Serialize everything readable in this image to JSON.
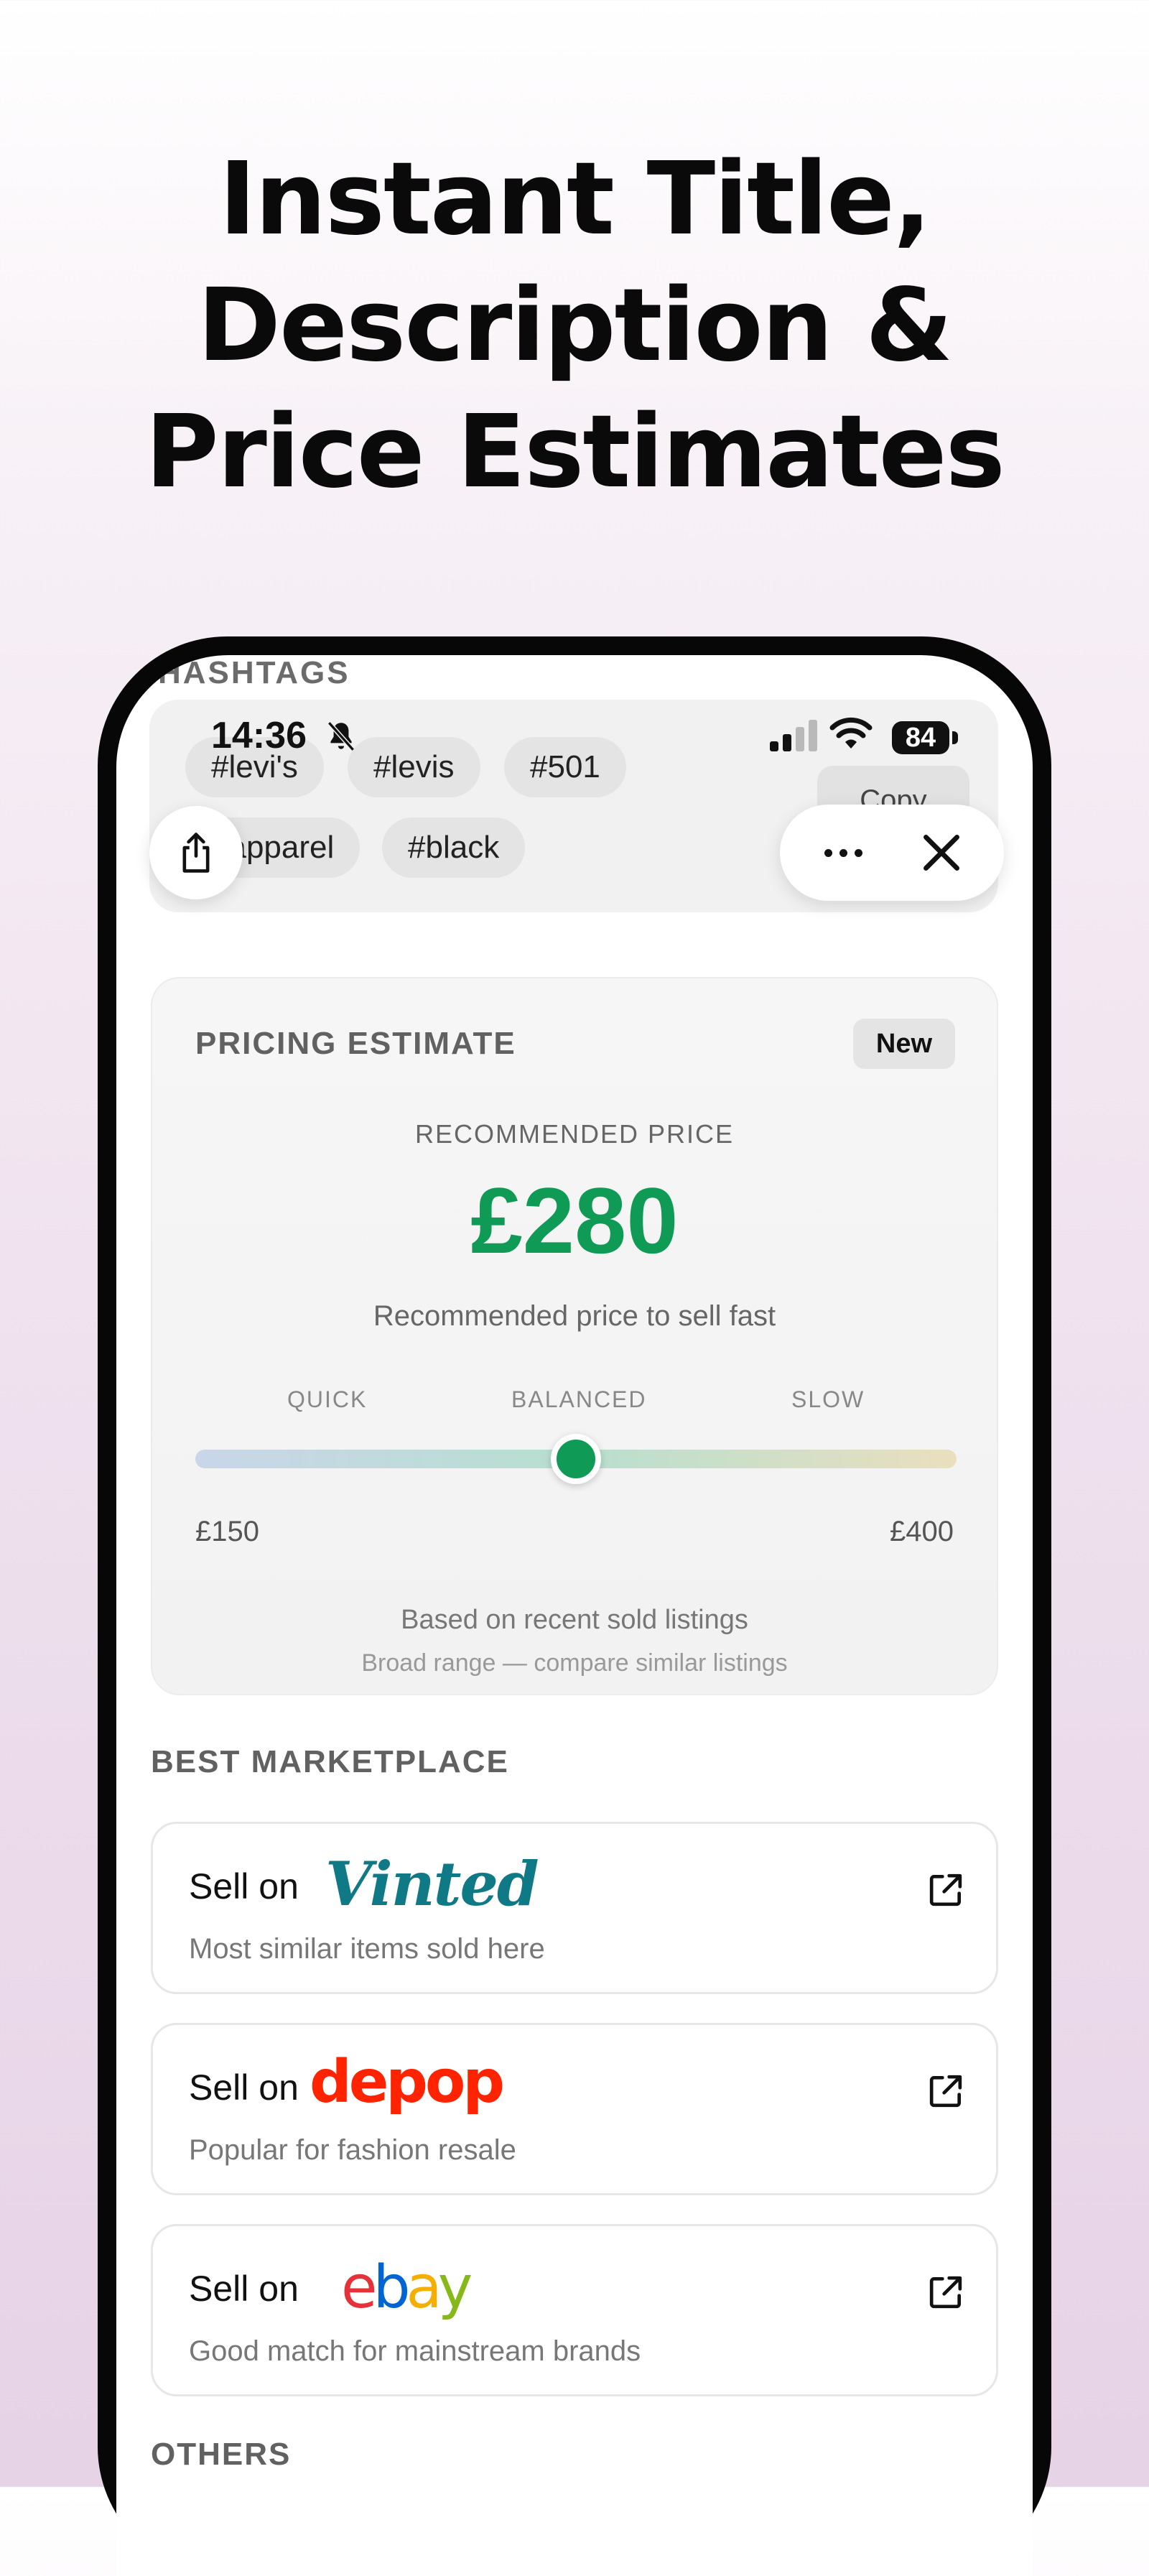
{
  "headline": {
    "line1": "Instant Title,",
    "line2": "Description &",
    "line3": "Price Estimates"
  },
  "status_bar": {
    "time": "14:36",
    "battery": "84"
  },
  "hashtags": {
    "label": "HASHTAGS",
    "tags": [
      "#levi's",
      "#levis",
      "#501",
      "#apparel",
      "#black"
    ],
    "copy_label": "Copy"
  },
  "pricing": {
    "title": "PRICING ESTIMATE",
    "badge": "New",
    "recommended_label": "RECOMMENDED PRICE",
    "price": "£280",
    "subtitle": "Recommended price to sell fast",
    "speeds": [
      "QUICK",
      "BALANCED",
      "SLOW"
    ],
    "min": "£150",
    "max": "£400",
    "slider_position": 0.5,
    "basis": "Based on recent sold listings",
    "basis_note": "Broad range — compare similar listings"
  },
  "marketplace": {
    "title": "BEST MARKETPLACE",
    "items": [
      {
        "sell_label": "Sell on",
        "logo_text": "Vinted",
        "subtitle": "Most similar items sold here",
        "color": "#0f7a86"
      },
      {
        "sell_label": "Sell on",
        "logo_text": "depop",
        "subtitle": "Popular for fashion resale",
        "color": "#ff2300"
      },
      {
        "sell_label": "Sell on",
        "logo_text": "ebay",
        "subtitle": "Good match for mainstream brands",
        "color": "#e53238"
      }
    ]
  },
  "others": {
    "title": "OTHERS"
  },
  "colors": {
    "accent_green": "#0f9a55",
    "ebay_e": "#e53238",
    "ebay_b": "#0064d2",
    "ebay_a": "#f5af02",
    "ebay_y": "#86b817"
  }
}
